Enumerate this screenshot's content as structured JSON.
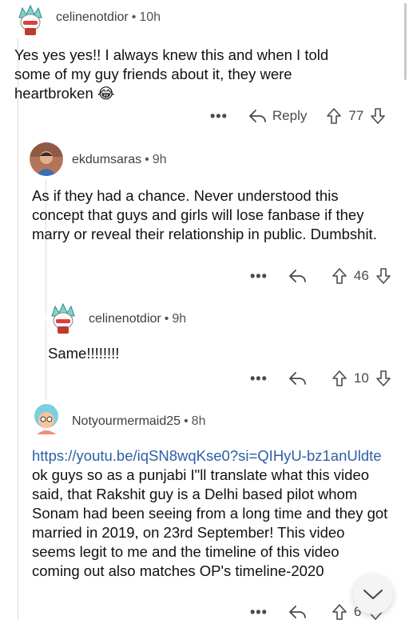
{
  "comments": [
    {
      "username": "celinenotdior",
      "time": "10h",
      "text": "Yes yes yes!! I always knew this and when I told some of my guy friends about it, they were heartbroken",
      "emoji": "😂",
      "reply_label": "Reply",
      "votes": "77"
    },
    {
      "username": "ekdumsaras",
      "time": "9h",
      "text": "As if they had a chance. Never understood this concept that guys and girls will lose fanbase if they marry or reveal their relationship in public. Dumbshit.",
      "votes": "46"
    },
    {
      "username": "celinenotdior",
      "time": "9h",
      "text": "Same!!!!!!!!",
      "votes": "10"
    },
    {
      "username": "Notyourmermaid25",
      "time": "8h",
      "link": "https://youtu.be/iqSN8wqKse0?si=QIHyU-bz1anUldte",
      "text": " ok guys so as a punjabi I\"ll translate what this video said, that Rakshit guy is a Delhi based pilot whom Sonam had been seeing from a long time and they got married in 2019, on 23rd September! This video seems legit to me and the timeline of this video coming out also matches OP's timeline-2020",
      "votes": "6"
    }
  ],
  "more_label": "•••",
  "separator": "•",
  "colors": {
    "link": "#2c5fa8",
    "meta": "#4f5458",
    "thread_line": "#dadce0"
  }
}
